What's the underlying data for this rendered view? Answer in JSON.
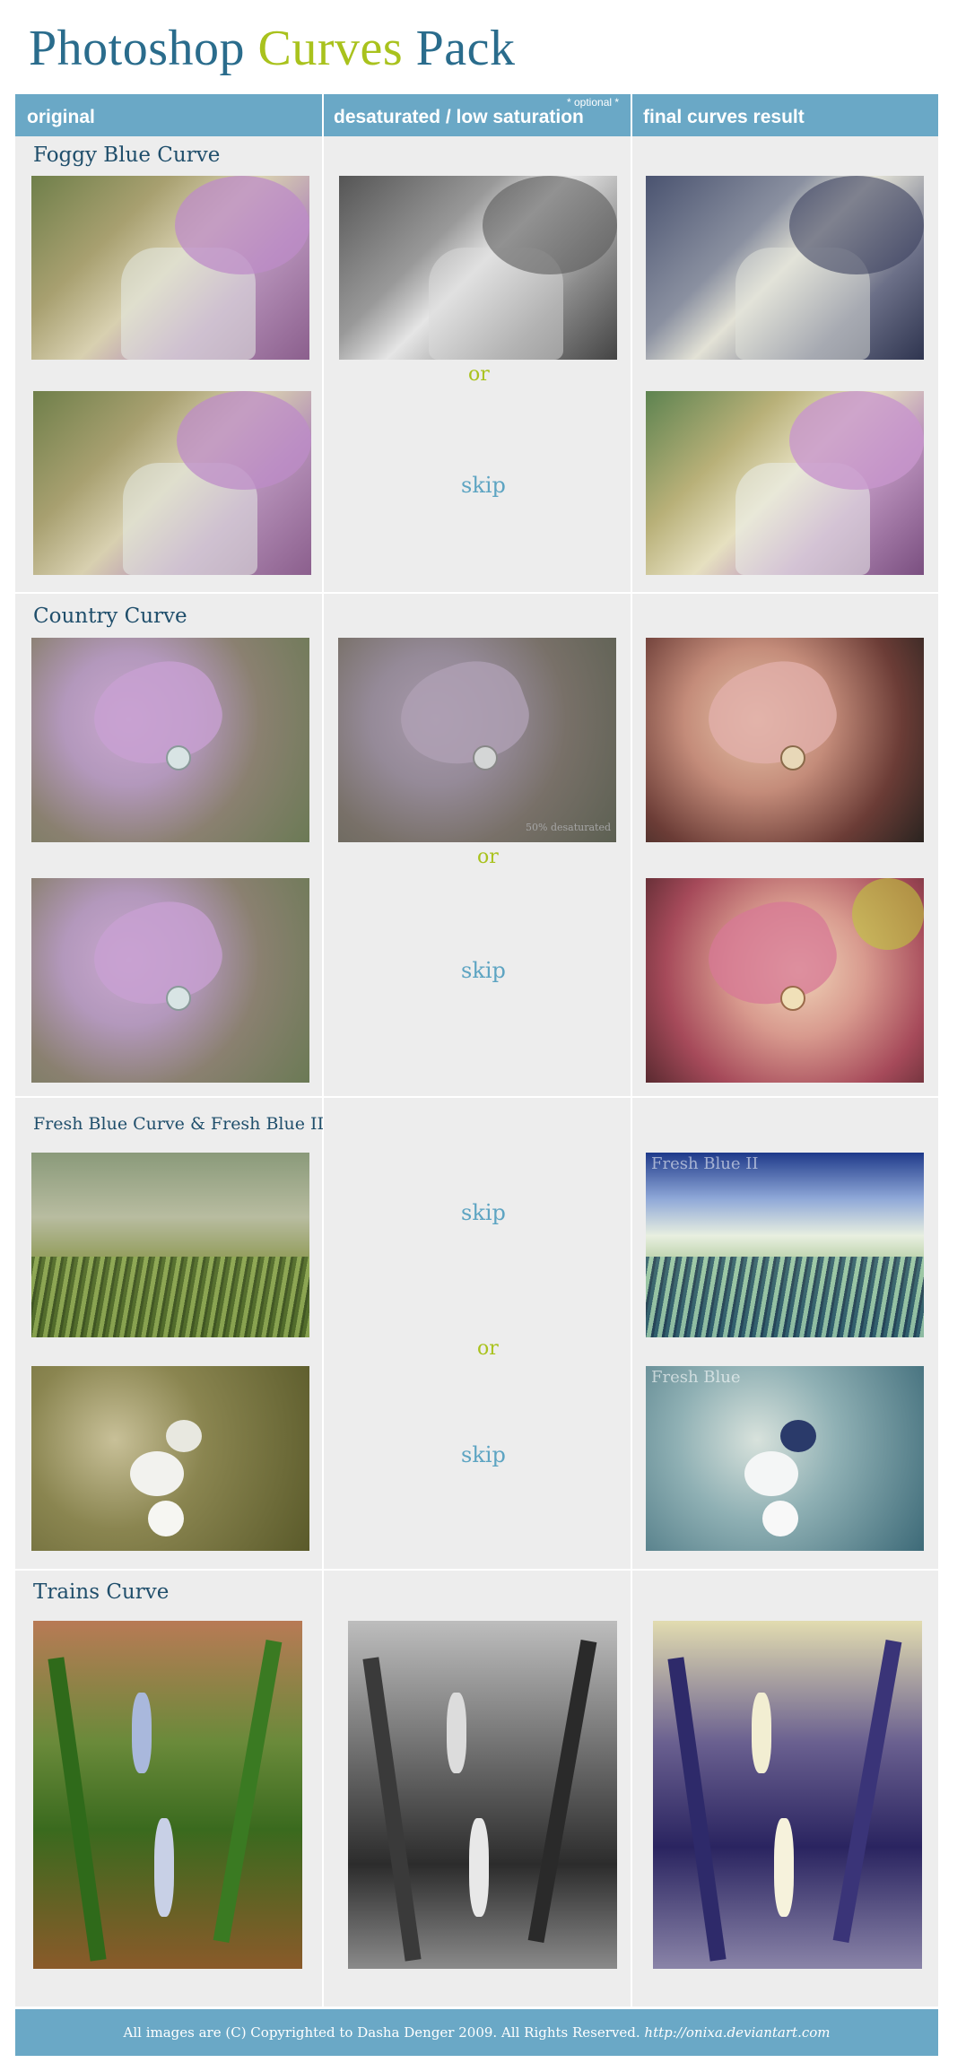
{
  "title": {
    "part1": "Photoshop ",
    "part2": "Curves",
    "part3": " Pack"
  },
  "header": {
    "col1": "original",
    "col2": "desaturated / low saturation",
    "col3": "final curves result",
    "optional": "* optional *"
  },
  "sections": [
    {
      "name": "Foggy Blue Curve",
      "or": "or",
      "skip": "skip"
    },
    {
      "name": "Country Curve",
      "or": "or",
      "skip": "skip",
      "desat_caption": "50% desaturated"
    },
    {
      "name": "Fresh Blue Curve & Fresh Blue II",
      "or": "or",
      "skip1": "skip",
      "skip2": "skip",
      "caption1": "Fresh Blue II",
      "caption2": "Fresh Blue"
    },
    {
      "name": "Trains Curve"
    }
  ],
  "footer": {
    "text": "All images are (C) Copyrighted to Dasha Denger 2009.  All Rights Reserved.  ",
    "link": "http://onixa.deviantart.com"
  },
  "colors": {
    "accent_blue": "#6aa8c6",
    "accent_green": "#a9c21d",
    "title_blue": "#2a6c8c"
  }
}
